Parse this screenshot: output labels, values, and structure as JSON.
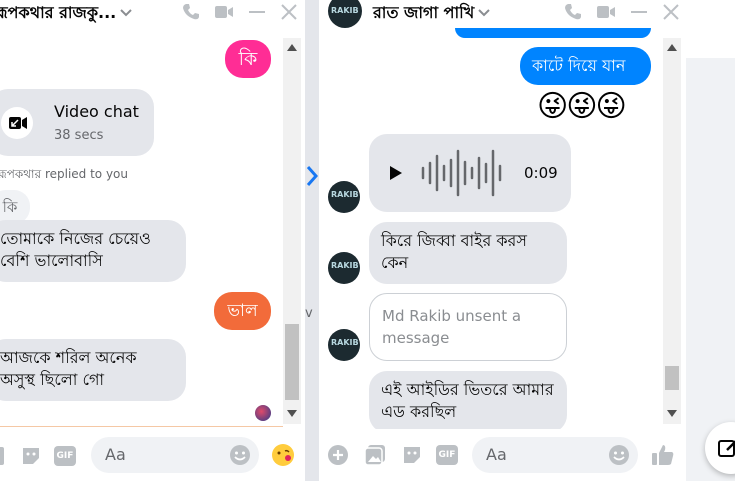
{
  "left_chat": {
    "title": "রূপকথার রাজকু...",
    "messages": {
      "ki_out": "কি",
      "video_call_title": "Video chat",
      "video_call_duration": "38 secs",
      "replied_note": "রূপকথার replied to you",
      "quoted_text": "কি",
      "msg1": "তোমাকে নিজের চেয়েও বেশি ভালোবাসি",
      "bhalo": "ভাল",
      "msg2": "আজকে শরিল অনেক অসুস্থ ছিলো গো"
    },
    "composer": {
      "placeholder": "Aa"
    }
  },
  "right_chat": {
    "title": "রাত জাগা পাখি",
    "messages": {
      "out1": "কাটে দিয়ে যান",
      "emojis": "😜😜😜",
      "voice_duration": "0:09",
      "in1": "কিরে জিব্বা বাইর করস কেন",
      "unsent": "Md Rakib unsent a message",
      "in2": "এই আইডির ভিতরে আমার এড করছিল"
    },
    "avatar_label": "RAKIB",
    "composer": {
      "placeholder": "Aa"
    }
  },
  "middle_fragment": "v",
  "icons": [
    "phone-icon",
    "video-icon",
    "minimize-icon",
    "close-icon",
    "chevron-down-icon",
    "video-call-icon",
    "play-icon",
    "waveform-icon",
    "plus-icon",
    "image-icon",
    "sticker-icon",
    "gif-icon",
    "emoji-icon",
    "like-icon",
    "compose-icon",
    "seen-avatar-icon"
  ],
  "colors": {
    "accent_blue": "#0084ff",
    "pink": "#ff2d95",
    "orange": "#f26b3a",
    "bubble_grey": "#e4e6eb"
  }
}
